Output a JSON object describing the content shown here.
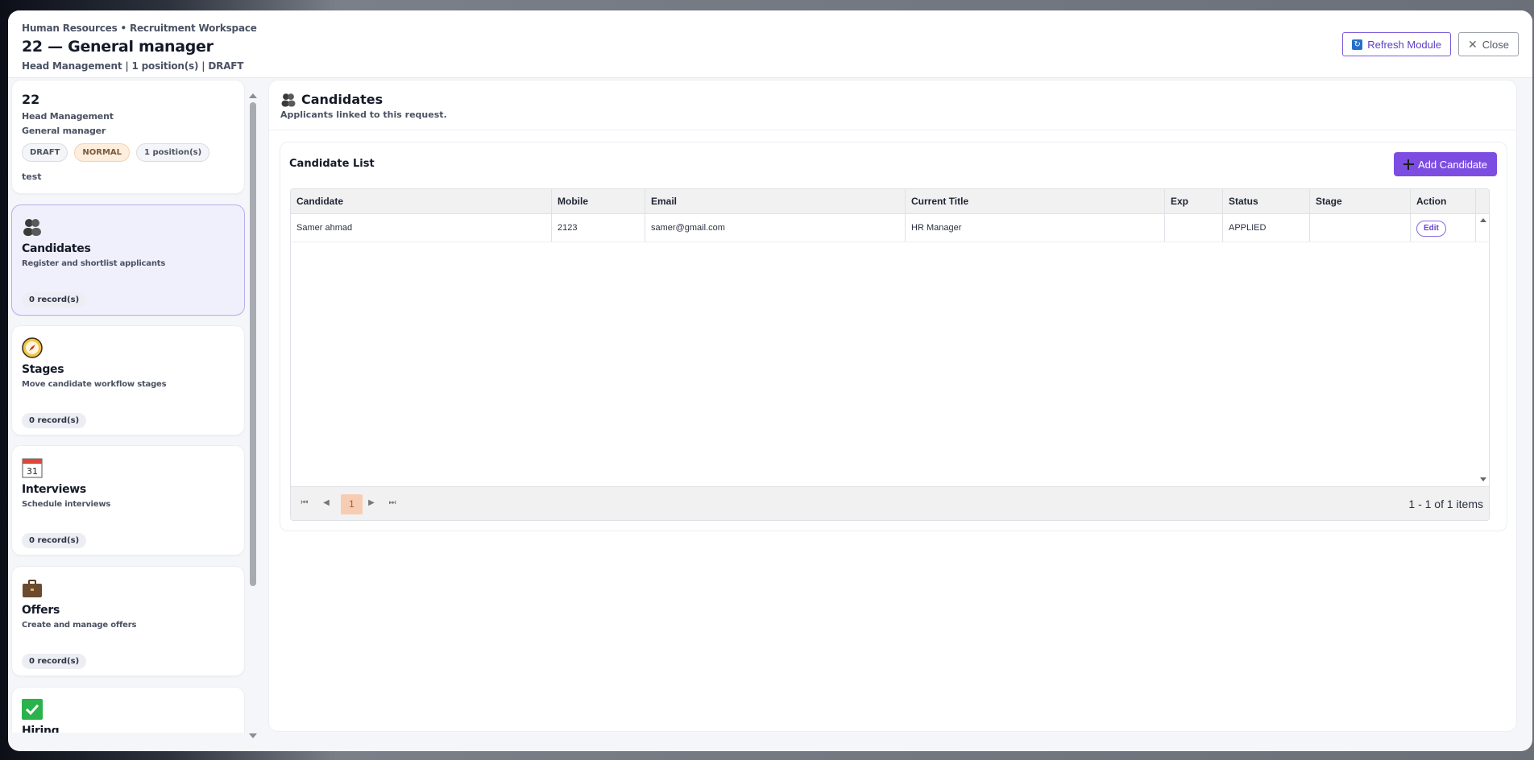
{
  "header": {
    "breadcrumb": "Human Resources • Recruitment Workspace",
    "title": "22 — General manager",
    "subtitle": "Head Management | 1 position(s) | DRAFT",
    "refresh_label": "Refresh Module",
    "close_label": "Close"
  },
  "summary": {
    "code": "22",
    "department": "Head Management",
    "position": "General manager",
    "chips": [
      "DRAFT",
      "NORMAL",
      "1 position(s)"
    ],
    "note": "test"
  },
  "modules": [
    {
      "title": "Candidates",
      "desc": "Register and shortlist applicants",
      "records": "0 record(s)",
      "icon": "people-icon"
    },
    {
      "title": "Stages",
      "desc": "Move candidate workflow stages",
      "records": "0 record(s)",
      "icon": "compass-icon"
    },
    {
      "title": "Interviews",
      "desc": "Schedule interviews",
      "records": "0 record(s)",
      "icon": "calendar-icon"
    },
    {
      "title": "Offers",
      "desc": "Create and manage offers",
      "records": "0 record(s)",
      "icon": "briefcase-icon"
    },
    {
      "title": "Hiring",
      "icon": "check-icon"
    }
  ],
  "calendar_day": "31",
  "main": {
    "title": "Candidates",
    "subtitle": "Applicants linked to this request.",
    "list_title": "Candidate List",
    "add_label": "Add Candidate",
    "columns": [
      "Candidate",
      "Mobile",
      "Email",
      "Current Title",
      "Exp",
      "Status",
      "Stage",
      "Action"
    ],
    "rows": [
      {
        "candidate": "Samer ahmad",
        "mobile": "2123",
        "email": "samer@gmail.com",
        "title": "HR Manager",
        "exp": "",
        "status": "APPLIED",
        "stage": "",
        "action": "Edit"
      }
    ],
    "pager": {
      "page": "1",
      "info": "1 - 1 of 1 items"
    }
  },
  "colors": {
    "accent": "#7c4de0",
    "active_border": "#b6b1ec",
    "normal_chip": "#fdeedd"
  }
}
